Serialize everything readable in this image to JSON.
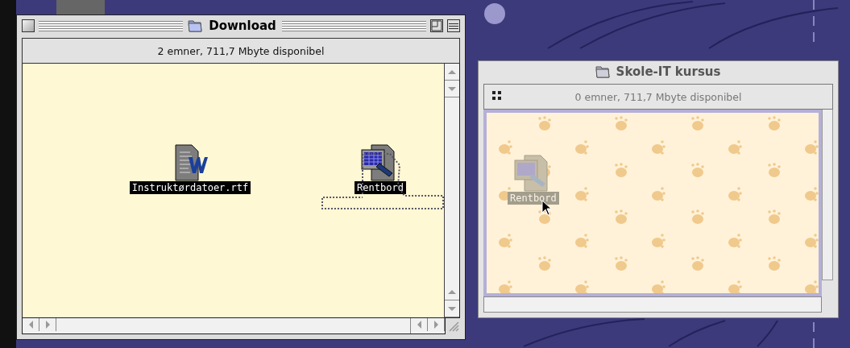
{
  "windows": [
    {
      "title": "Download",
      "active": true,
      "info": "2 emner, 711,7 Mbyte disponibel",
      "icons": [
        {
          "label": "Instruktørdatoer.rtf",
          "kind": "document",
          "selected": true
        },
        {
          "label": "Rentbord",
          "kind": "spreadsheet",
          "selected": true
        }
      ],
      "dragging": true
    },
    {
      "title": "Skole-IT kursus",
      "active": false,
      "info": "0 emner, 711,7 Mbyte disponibel",
      "ghost": {
        "label": "Rentbord",
        "kind": "spreadsheet"
      }
    }
  ]
}
